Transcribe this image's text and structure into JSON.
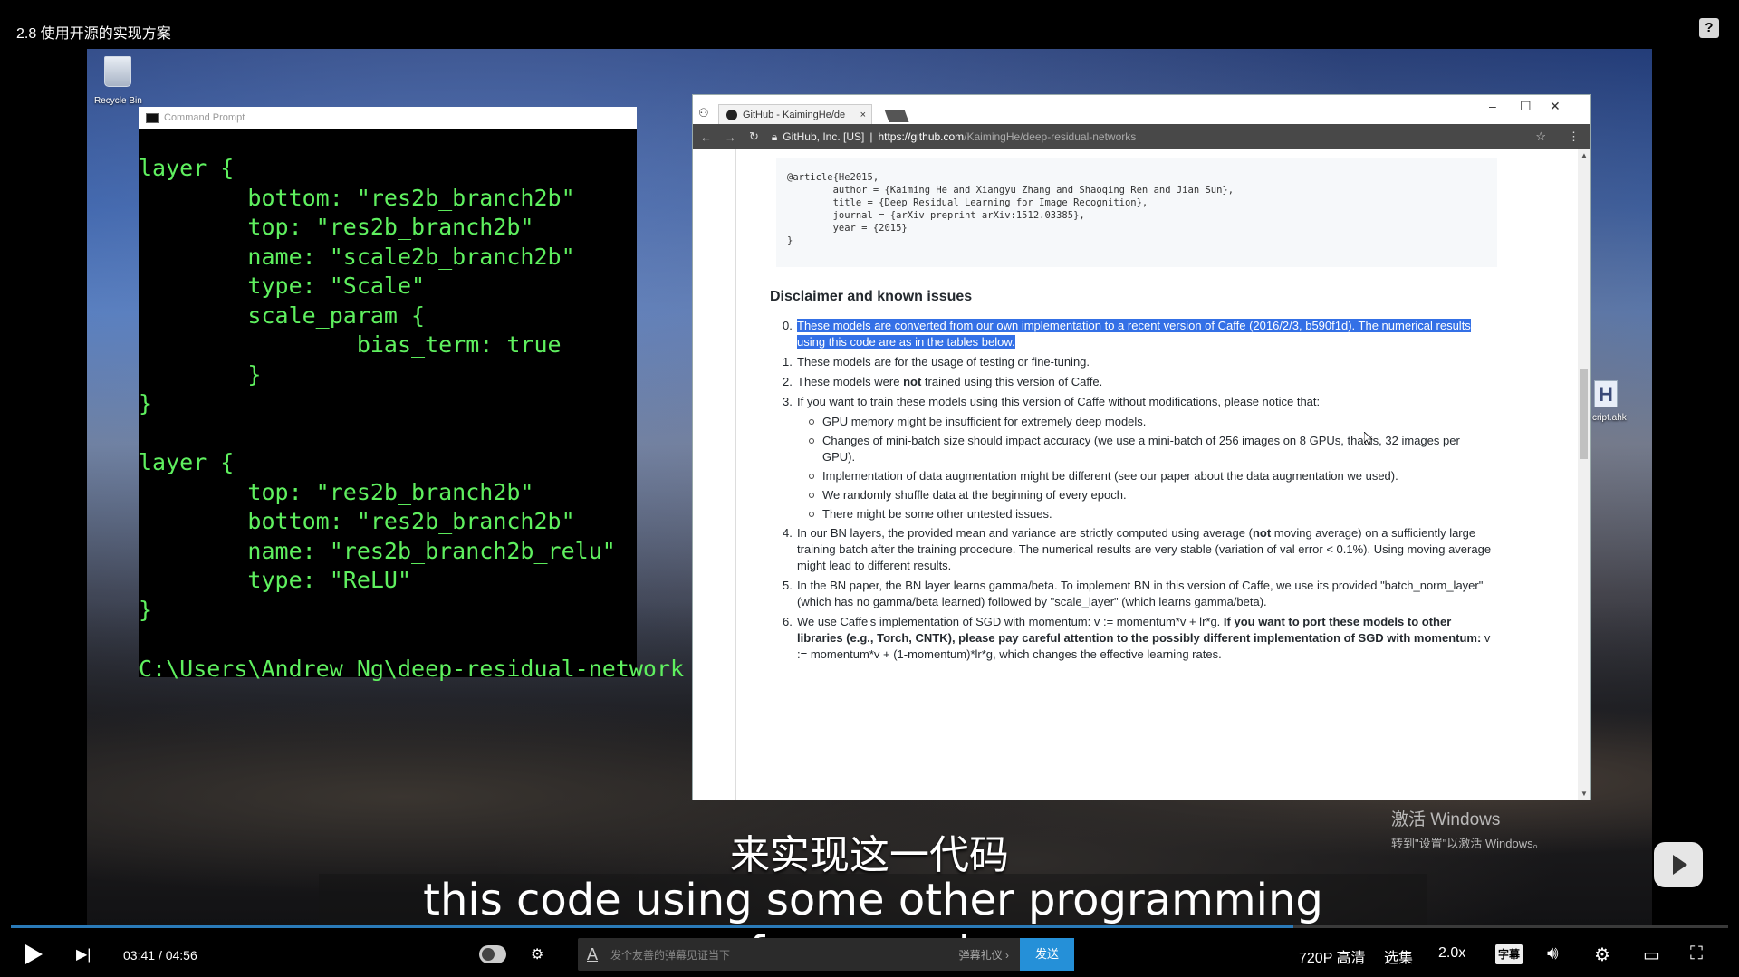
{
  "player": {
    "title": "2.8 使用开源的实现方案",
    "help_icon": "?",
    "current_time": "03:41",
    "separator": "/",
    "duration": "04:56",
    "progress": 0.7466,
    "danmu_placeholder": "发个友善的弹幕见证当下",
    "danmu_etiquette": "弹幕礼仪 ›",
    "send_label": "发送",
    "quality": "720P 高清",
    "episodes": "选集",
    "speed": "2.0x",
    "subtitle_label": "字幕",
    "colors": {
      "progress": "#2a7ab8",
      "send": "#2590d8"
    }
  },
  "subtitles": {
    "chinese": "来实现这一代码",
    "english": "this code using some other programming framework."
  },
  "desktop": {
    "recycle_bin_label": "Recycle Bin",
    "ahk_icon_letter": "H",
    "ahk_icon_label": "cript.ahk",
    "activate_line1": "激活 Windows",
    "activate_line2": "转到\"设置\"以激活 Windows。"
  },
  "cmd": {
    "title": "Command Prompt",
    "lines": [
      "layer {",
      "        bottom: \"res2b_branch2b\"",
      "        top: \"res2b_branch2b\"",
      "        name: \"scale2b_branch2b\"",
      "        type: \"Scale\"",
      "        scale_param {",
      "                bias_term: true",
      "        }",
      "}",
      "",
      "layer {",
      "        top: \"res2b_branch2b\"",
      "        bottom: \"res2b_branch2b\"",
      "        name: \"res2b_branch2b_relu\"",
      "        type: \"ReLU\"",
      "}",
      "",
      "C:\\Users\\Andrew Ng\\deep-residual-network"
    ]
  },
  "browser": {
    "tab_title": "GitHub - KaimingHe/de",
    "tab_close": "×",
    "secure_label": "GitHub, Inc. [US]",
    "url_host": "https://github.com",
    "url_path": "/KaimingHe/deep-residual-networks",
    "code": "@article{He2015,\n        author = {Kaiming He and Xiangyu Zhang and Shaoqing Ren and Jian Sun},\n        title = {Deep Residual Learning for Image Recognition},\n        journal = {arXiv preprint arXiv:1512.03385},\n        year = {2015}\n}",
    "heading": "Disclaimer and known issues",
    "items": [
      {
        "num": "0.",
        "text": "These models are converted from our own implementation to a recent version of Caffe (2016/2/3, b590f1d). The numerical results using this code are as in the tables below."
      },
      {
        "num": "1.",
        "text": "These models are for the usage of testing or fine-tuning."
      },
      {
        "num": "2.",
        "text_a": "These models were ",
        "text_b": "not",
        "text_c": " trained using this version of Caffe."
      },
      {
        "num": "3.",
        "text": "If you want to train these models using this version of Caffe without modifications, please notice that:"
      }
    ],
    "subitems": [
      "GPU memory might be insufficient for extremely deep models.",
      "Changes of mini-batch size should impact accuracy (we use a mini-batch of 256 images on 8 GPUs, that is, 32 images per GPU).",
      "Implementation of data augmentation might be different (see our paper about the data augmentation we used).",
      "We randomly shuffle data at the beginning of every epoch.",
      "There might be some other untested issues."
    ],
    "item4": {
      "num": "4.",
      "a": "In our BN layers, the provided mean and variance are strictly computed using average (",
      "b": "not",
      "c": " moving average) on a sufficiently large training batch after the training procedure. The numerical results are very stable (variation of val error < 0.1%). Using moving average might lead to different results."
    },
    "item5": {
      "num": "5.",
      "text": "In the BN paper, the BN layer learns gamma/beta. To implement BN in this version of Caffe, we use its provided \"batch_norm_layer\" (which has no gamma/beta learned) followed by \"scale_layer\" (which learns gamma/beta)."
    },
    "item6": {
      "num": "6.",
      "a": "We use Caffe's implementation of SGD with momentum: v := momentum*v + lr*g. ",
      "b": "If you want to port these models to other libraries (e.g., Torch, CNTK), please pay careful attention to the possibly different implementation of SGD with momentum:",
      "c": " v := momentum*v + (1-momentum)*lr*g, which changes the effective learning rates."
    }
  }
}
